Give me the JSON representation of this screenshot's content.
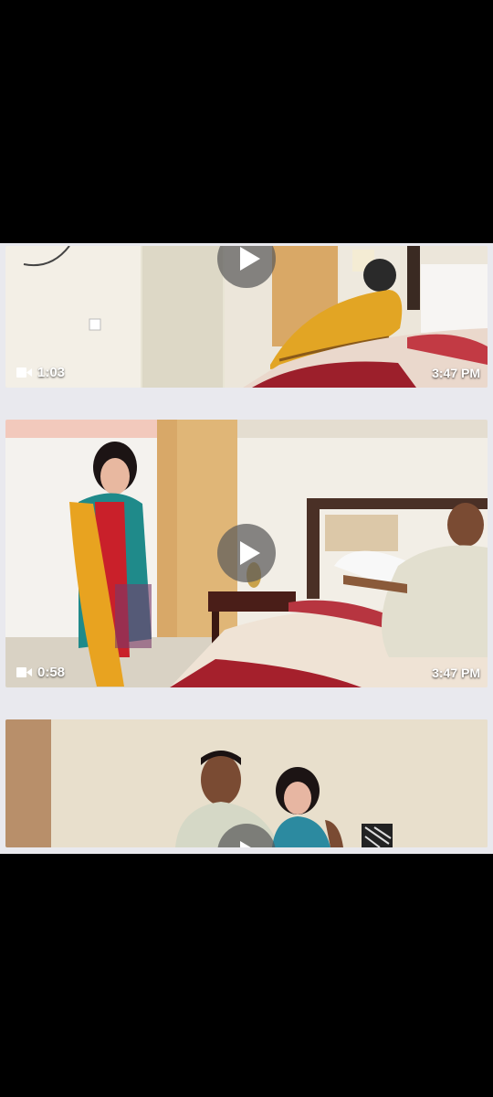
{
  "videos": [
    {
      "duration": "1:03",
      "timestamp": "3:47 PM"
    },
    {
      "duration": "0:58",
      "timestamp": "3:47 PM"
    },
    {
      "duration": "",
      "timestamp": ""
    }
  ],
  "icons": {
    "duration": "video-camera-icon",
    "play": "play-icon"
  },
  "colors": {
    "background": "#000000",
    "panel": "#e9e9ee",
    "overlay_text": "#ffffff"
  }
}
